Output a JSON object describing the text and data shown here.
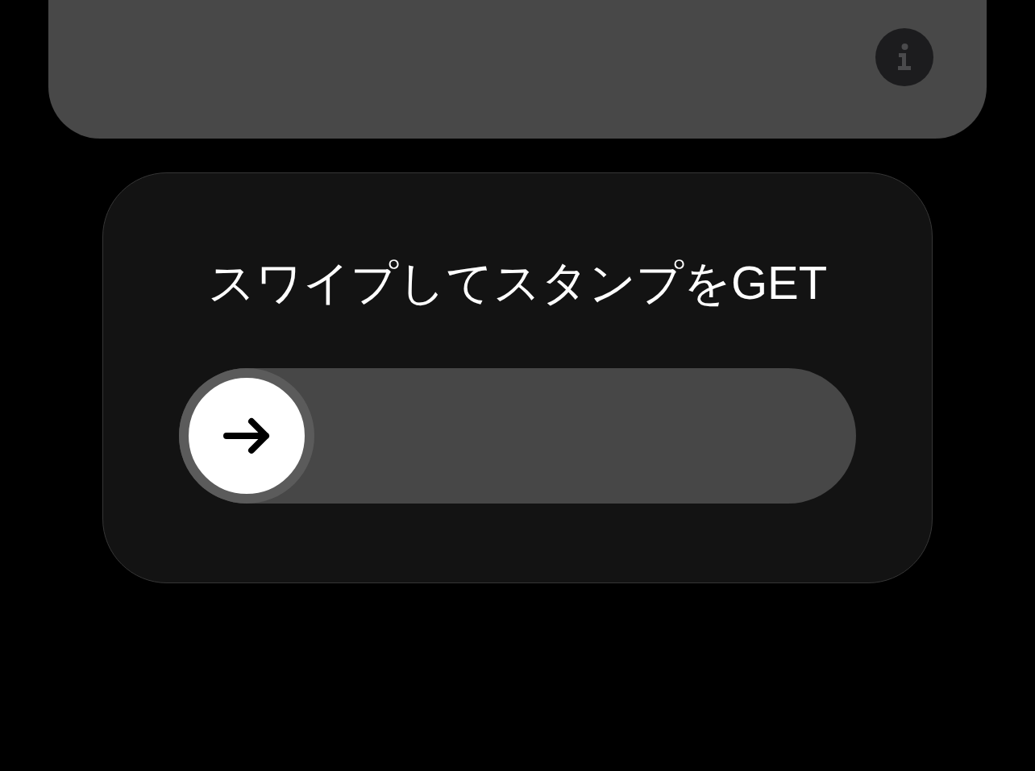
{
  "swipe_card": {
    "title": "スワイプしてスタンプをGET",
    "slider": {
      "level": 0
    }
  }
}
